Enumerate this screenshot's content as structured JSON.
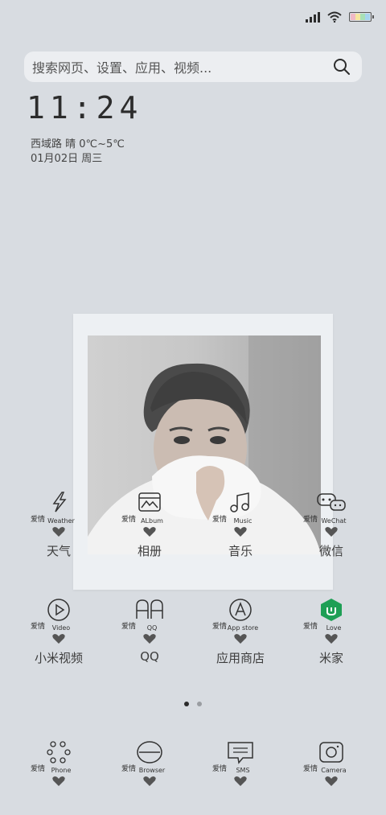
{
  "status_bar": {
    "battery_colors": [
      "#f0b9c6",
      "#f5e7a0",
      "#a8e0b6",
      "#a6d4ee"
    ]
  },
  "search": {
    "placeholder": "搜索网页、设置、应用、视频..."
  },
  "clock": {
    "time": "11:24",
    "weather": "西域路 晴 0℃~5℃",
    "date": "01月02日 周三"
  },
  "apps_row1": [
    {
      "en": "Weather",
      "cn": "天气"
    },
    {
      "en": "ALbum",
      "cn": "相册"
    },
    {
      "en": "Music",
      "cn": "音乐"
    },
    {
      "en": "WeChat",
      "cn": "微信"
    }
  ],
  "apps_row2": [
    {
      "en": "Video",
      "cn": "小米视频"
    },
    {
      "en": "QQ",
      "cn": "QQ"
    },
    {
      "en": "App store",
      "cn": "应用商店"
    },
    {
      "en": "Love",
      "cn": "米家"
    }
  ],
  "dock": [
    {
      "en": "Phone"
    },
    {
      "en": "Browser"
    },
    {
      "en": "SMS"
    },
    {
      "en": "Camera"
    }
  ],
  "love_tag": "爱情",
  "mi_home_color": "#1e9f55"
}
